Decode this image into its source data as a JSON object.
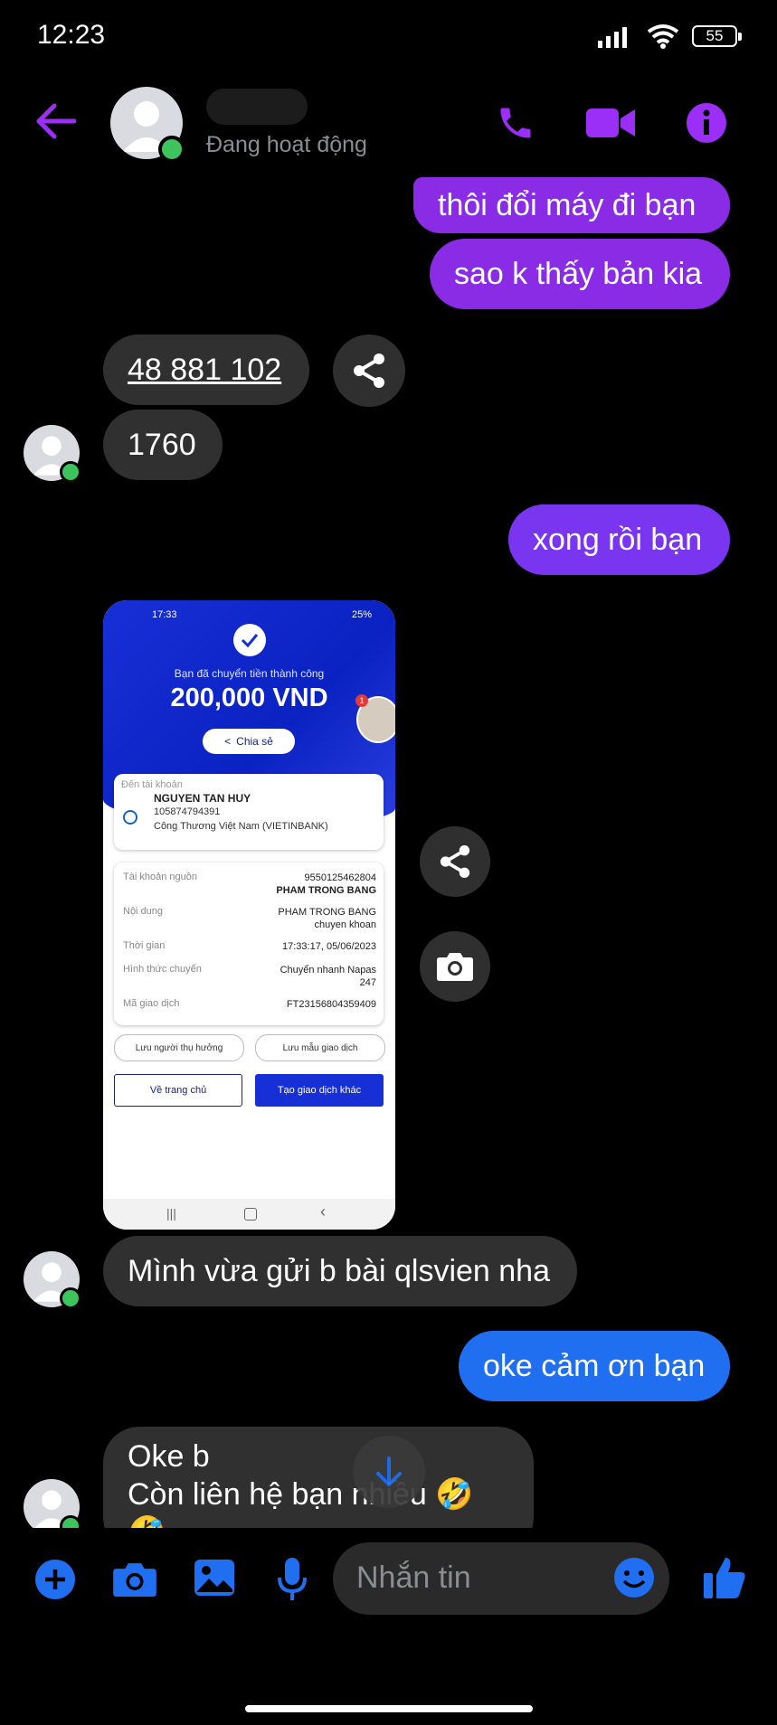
{
  "status_bar": {
    "time": "12:23",
    "battery": "55"
  },
  "header": {
    "contact_status": "Đang hoạt động"
  },
  "messages": {
    "m1": "thôi đổi máy đi bạn",
    "m2": "sao k thấy bản kia",
    "m3": "48 881 102",
    "m4": "1760",
    "m5": "xong rồi bạn",
    "m7": "Mình vừa gửi b bài qlsvien nha",
    "m8": "oke cảm ơn bạn",
    "m9_line1": "Oke b",
    "m9_line2": "Còn liên hệ bạn nhiều 🤣🤣"
  },
  "shared_image": {
    "status_time": "17:33",
    "status_right": "25%",
    "success_text": "Bạn đã chuyển tiền thành công",
    "amount": "200,000 VND",
    "share_label": "Chia sẻ",
    "notif_count": "1",
    "to_account_label": "Đến tài khoản",
    "recipient_name": "NGUYEN TAN HUY",
    "recipient_account": "105874794391",
    "recipient_bank": "Công Thương Việt Nam (VIETINBANK)",
    "rows": [
      {
        "label": "Tài khoản nguồn",
        "value1": "9550125462804",
        "value2": "PHAM TRONG BANG"
      },
      {
        "label": "Nội dung",
        "value1": "PHAM TRONG BANG",
        "value2": "chuyen khoan"
      },
      {
        "label": "Thời gian",
        "value1": "17:33:17, 05/06/2023",
        "value2": ""
      },
      {
        "label": "Hình thức chuyển",
        "value1": "Chuyển nhanh Napas",
        "value2": "247"
      },
      {
        "label": "Mã giao dịch",
        "value1": "FT23156804359409",
        "value2": ""
      }
    ],
    "save_beneficiary": "Lưu người thụ hưởng",
    "save_template": "Lưu mẫu giao dịch",
    "home_button": "Về trang chủ",
    "new_transaction_button": "Tạo giao dịch khác"
  },
  "composer": {
    "placeholder": "Nhắn tin"
  },
  "colors": {
    "accent_purple": "#9b2ff7",
    "messenger_blue": "#1f6ff0",
    "bubble_grey": "#303030"
  }
}
